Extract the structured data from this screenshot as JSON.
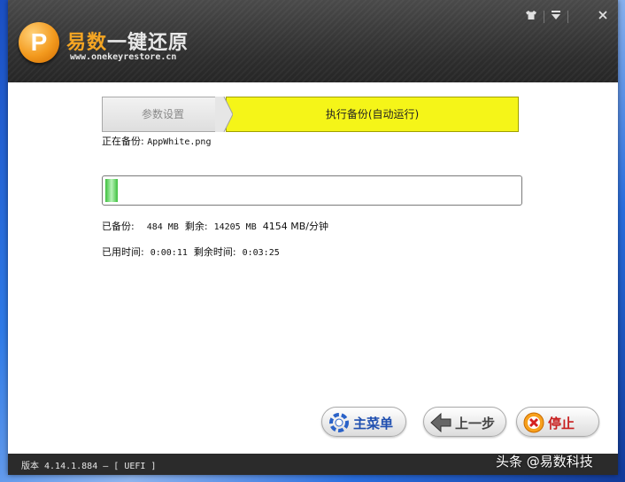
{
  "app": {
    "logo_letter": "P",
    "title_accent": "易数",
    "title_rest": "一键还原",
    "url": "www.onekeyrestore.cn"
  },
  "window_buttons": [
    "skin-icon",
    "menu-icon",
    "close-icon"
  ],
  "steps": [
    {
      "label": "参数设置",
      "active": false
    },
    {
      "label": "执行备份(自动运行)",
      "active": true
    }
  ],
  "backup": {
    "current_file_label": "正在备份:",
    "current_file": "AppWhite.png",
    "progress_fraction": 0.03,
    "done_label": "已备份:",
    "done_value": "484 MB",
    "remaining_label": "剩余:",
    "remaining_value": "14205 MB",
    "speed": "4154 MB/分钟",
    "elapsed_label": "已用时间:",
    "elapsed_value": "0:00:11",
    "time_left_label": "剩余时间:",
    "time_left_value": "0:03:25"
  },
  "buttons": {
    "main_menu": "主菜单",
    "prev_step": "上一步",
    "stop": "停止"
  },
  "status": {
    "version_text": "版本 4.14.1.884 — [ UEFI ]"
  },
  "watermark": "头条 @易数科技",
  "colors": {
    "active_step": "#f5f518",
    "progress": "#3ec03e",
    "title_accent": "#f5a623"
  }
}
